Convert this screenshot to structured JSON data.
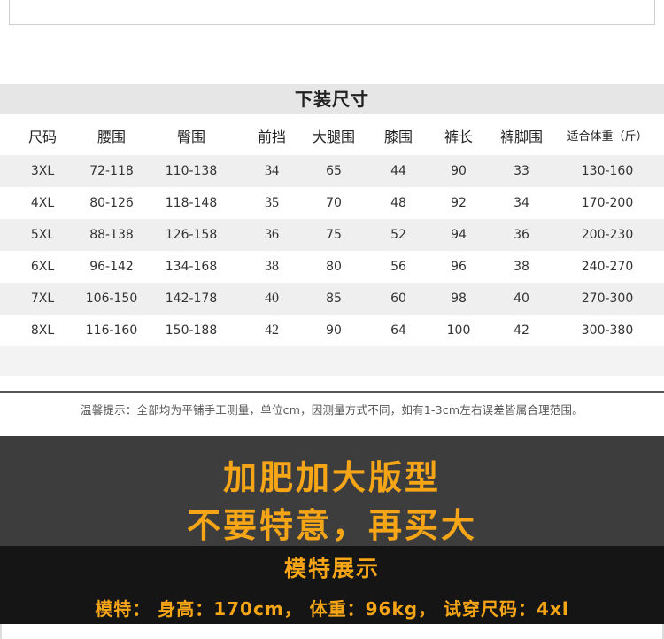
{
  "title": "下装尺寸",
  "headers": [
    "尺码",
    "腰围",
    "臀围",
    "前挡",
    "大腿围",
    "膝围",
    "裤长",
    "裤脚围",
    "适合体重（斤）"
  ],
  "rows": [
    [
      "3XL",
      "72-118",
      "110-138",
      "34",
      "65",
      "44",
      "90",
      "33",
      "130-160"
    ],
    [
      "4XL",
      "80-126",
      "118-148",
      "35",
      "70",
      "48",
      "92",
      "34",
      "170-200"
    ],
    [
      "5XL",
      "88-138",
      "126-158",
      "36",
      "75",
      "52",
      "94",
      "36",
      "200-230"
    ],
    [
      "6XL",
      "96-142",
      "134-168",
      "38",
      "80",
      "56",
      "96",
      "38",
      "240-270"
    ],
    [
      "7XL",
      "106-150",
      "142-178",
      "40",
      "85",
      "60",
      "98",
      "40",
      "270-300"
    ],
    [
      "8XL",
      "116-160",
      "150-188",
      "42",
      "90",
      "64",
      "100",
      "42",
      "300-380"
    ]
  ],
  "note": "温馨提示：全部均为平铺手工测量，单位cm，因测量方式不同，如有1-3cm左右误差皆属合理范围。",
  "promo": {
    "line1": "加肥加大版型",
    "line2": "不要特意，再买大"
  },
  "model": {
    "title": "模特展示",
    "info": "模特：  身高：170cm， 体重：96kg， 试穿尺码：4xl"
  },
  "colors": {
    "accent": "#f6a516",
    "promo_bg": "#3d3d3d",
    "model_bg": "#151515",
    "row_shade": "#efefef",
    "title_band": "#e6e6e6"
  }
}
